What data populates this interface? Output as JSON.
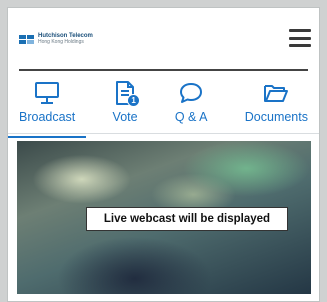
{
  "header": {
    "logo_line1": "Hutchison Telecom",
    "logo_line2": "Hong Kong Holdings"
  },
  "tabs": [
    {
      "label": "Broadcast",
      "icon": "monitor-icon",
      "active": true
    },
    {
      "label": "Vote",
      "icon": "document-icon",
      "badge": "1"
    },
    {
      "label": "Q & A",
      "icon": "speech-bubble-icon"
    },
    {
      "label": "Documents",
      "icon": "folder-icon"
    }
  ],
  "video": {
    "message": "Live webcast will be displayed"
  },
  "colors": {
    "accent": "#1a73c7",
    "page_background": "#cfd1d1"
  }
}
